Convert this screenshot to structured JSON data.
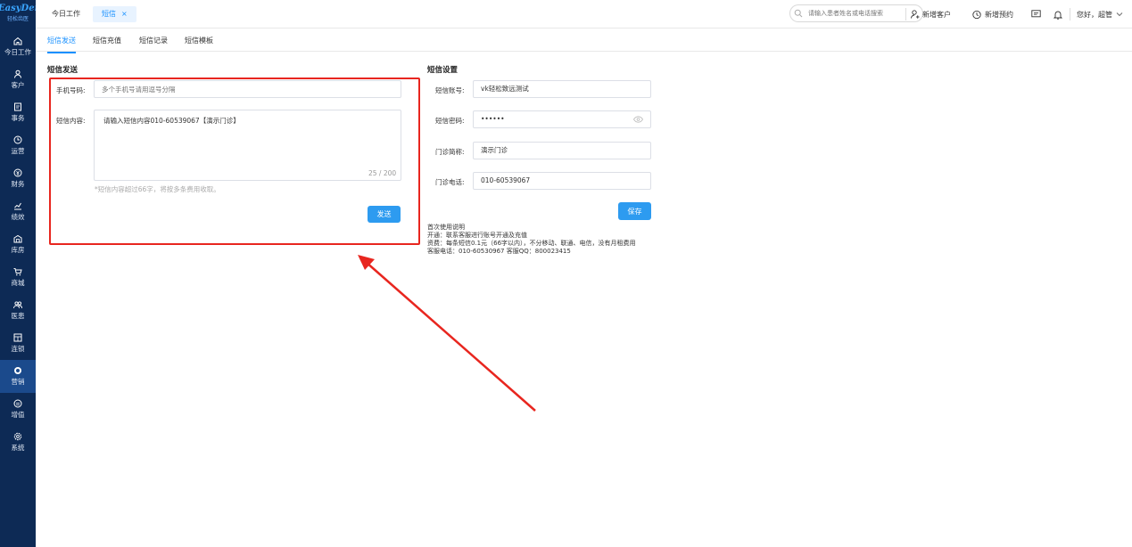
{
  "logo": {
    "main": "EasyDent",
    "sub": "轻松齿医"
  },
  "sidebar": {
    "items": [
      {
        "label": "今日工作",
        "icon": "home-icon"
      },
      {
        "label": "客户",
        "icon": "user-icon"
      },
      {
        "label": "事务",
        "icon": "task-icon"
      },
      {
        "label": "运营",
        "icon": "clock-icon"
      },
      {
        "label": "财务",
        "icon": "money-icon"
      },
      {
        "label": "绩效",
        "icon": "chart-icon"
      },
      {
        "label": "库房",
        "icon": "warehouse-icon"
      },
      {
        "label": "商城",
        "icon": "cart-icon"
      },
      {
        "label": "医患",
        "icon": "people-icon"
      },
      {
        "label": "连锁",
        "icon": "chain-icon"
      },
      {
        "label": "营销",
        "icon": "marketing-icon"
      },
      {
        "label": "增值",
        "icon": "value-icon"
      },
      {
        "label": "系统",
        "icon": "settings-icon"
      }
    ],
    "active_index": 10
  },
  "topbar": {
    "tabs": [
      {
        "label": "今日工作"
      },
      {
        "label": "短信",
        "close": "×"
      }
    ],
    "search_placeholder": "请输入患者姓名或电话搜索",
    "new_customer": "新增客户",
    "new_appointment": "新增预约",
    "greeting": "您好，超管"
  },
  "subtabs": [
    "短信发送",
    "短信充值",
    "短信记录",
    "短信模板"
  ],
  "send": {
    "title": "短信发送",
    "phone_label": "手机号码:",
    "phone_placeholder": "多个手机号请用逗号分隔",
    "content_label": "短信内容:",
    "content_value": "请输入短信内容010-60539067【演示门诊】",
    "counter": "25 / 200",
    "hint": "*短信内容超过66字，将按多条费用收取。",
    "send_button": "发送"
  },
  "settings": {
    "title": "短信设置",
    "account_label": "短信账号:",
    "account_value": "vk轻松致远测试",
    "password_label": "短信密码:",
    "password_value": "••••••",
    "clinic_label": "门诊简称:",
    "clinic_value": "演示门诊",
    "phone_label": "门诊电话:",
    "phone_value": "010-60539067",
    "save_button": "保存"
  },
  "instructions": [
    "首次使用说明",
    "开通：联系客服进行账号开通及充值",
    "资费：每条短信0.1元（66字以内），不分移动、联通、电信，没有月租费用",
    "客服电话：010-60530967  客服QQ：800023415"
  ],
  "colors": {
    "accent": "#1890ff",
    "sidebar": "#0d2a55",
    "highlight": "#e8261f"
  }
}
